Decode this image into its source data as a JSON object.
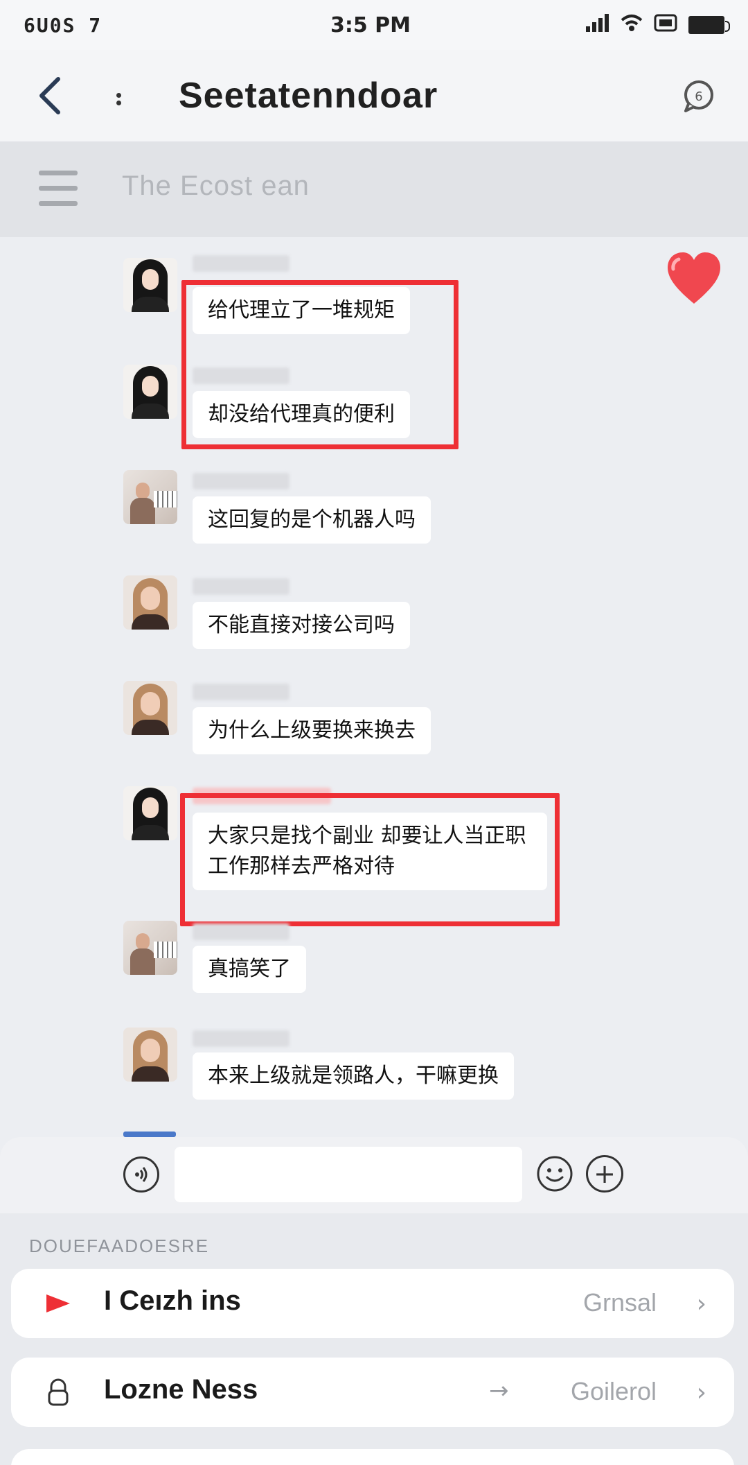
{
  "status_bar": {
    "carrier": "6U0S 7",
    "time": "3:5 PM",
    "icons": [
      "signal-icon",
      "wifi-icon",
      "network-icon",
      "battery-icon"
    ]
  },
  "header": {
    "title": "Seetatenndoar",
    "back_icon": "chevron-left-icon",
    "more_icon": "vertical-dots-icon",
    "chat_icon": "chat-bubble-icon"
  },
  "subheader": {
    "menu_icon": "menu-icon",
    "title": "The Ecost ean"
  },
  "messages": [
    {
      "avatar": "dark-hair-woman",
      "text": "给代理立了一堆规矩",
      "highlighted": true
    },
    {
      "avatar": "dark-hair-woman",
      "text": "却没给代理真的便利",
      "highlighted": true
    },
    {
      "avatar": "piano-child",
      "text": "这回复的是个机器人吗",
      "highlighted": false
    },
    {
      "avatar": "blonde-woman",
      "text": "不能直接对接公司吗",
      "highlighted": false
    },
    {
      "avatar": "blonde-woman",
      "text": "为什么上级要换来换去",
      "highlighted": false
    },
    {
      "avatar": "dark-hair-woman",
      "text": "大家只是找个副业 却要让人当正职工作那样去严格对待",
      "highlighted": true
    },
    {
      "avatar": "piano-child",
      "text": "真搞笑了",
      "highlighted": false
    },
    {
      "avatar": "blonde-woman",
      "text": "本来上级就是领路人，干嘛更换",
      "highlighted": false
    }
  ],
  "decorations": {
    "heart_icon": "heart-icon",
    "accent_red": "#ee2f35"
  },
  "input_bar": {
    "voice_icon": "voice-icon",
    "placeholder": "",
    "emoji_icon": "emoji-icon",
    "plus_icon": "plus-icon"
  },
  "settings": {
    "section_label": "DOUEFAADOESRE",
    "rows": [
      {
        "icon": "play-icon",
        "title": "I Ceızh ins",
        "value": "Grnsal",
        "chevron": "›"
      },
      {
        "icon": "lock-icon",
        "title": "Lozne Ness",
        "arrow": "→",
        "value": "Goilerol",
        "chevron": "›"
      }
    ]
  }
}
